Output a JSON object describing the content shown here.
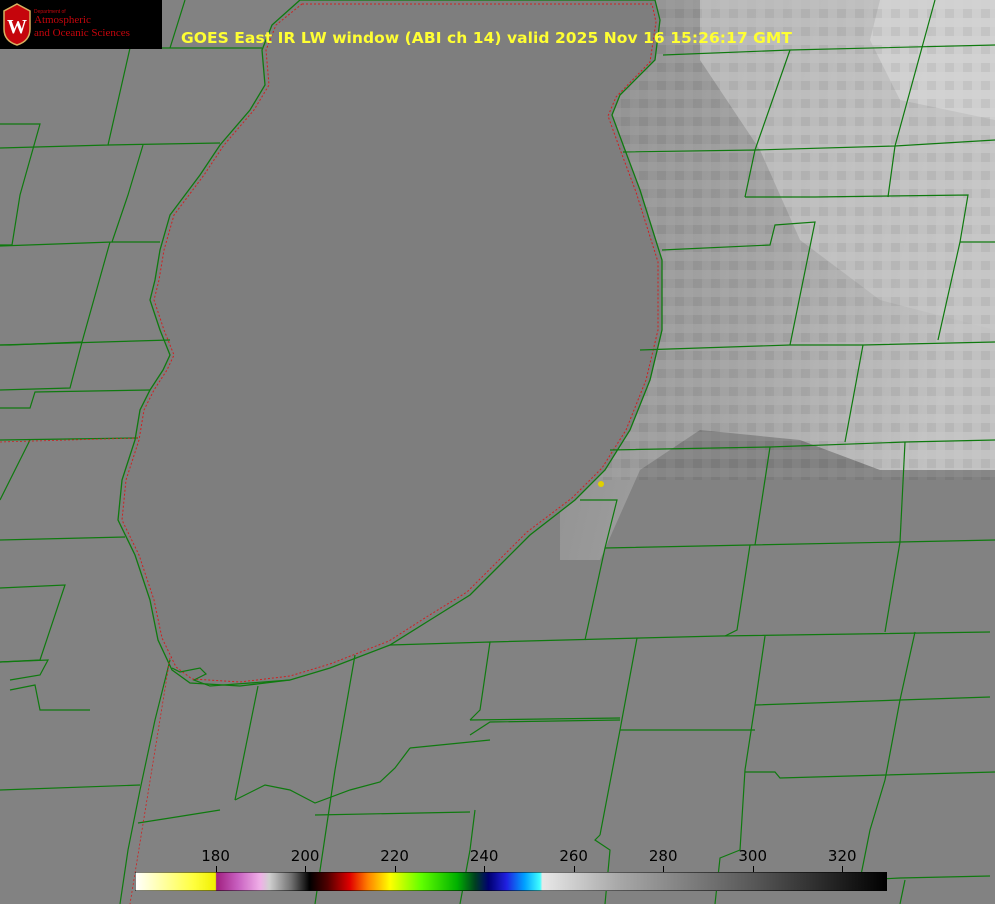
{
  "product_title": "GOES East IR LW window (ABI ch 14) valid 2025 Nov 16 15:26:17 GMT",
  "logo": {
    "department": "Department of",
    "line1": "Atmospheric",
    "line2": "and Oceanic Sciences",
    "crest_letter": "W"
  },
  "colorbar": {
    "unit_range": [
      162,
      330
    ],
    "ticks": [
      "180",
      "200",
      "220",
      "240",
      "260",
      "280",
      "300",
      "320"
    ],
    "stops": [
      {
        "t": 162,
        "c": "#ffffff"
      },
      {
        "t": 175,
        "c": "#ffff40"
      },
      {
        "t": 180,
        "c": "#f0f000"
      },
      {
        "t": 180.2,
        "c": "#a02080"
      },
      {
        "t": 185,
        "c": "#c860c0"
      },
      {
        "t": 190,
        "c": "#f0b0e8"
      },
      {
        "t": 192,
        "c": "#d0d0d0"
      },
      {
        "t": 197,
        "c": "#707070"
      },
      {
        "t": 201,
        "c": "#000000"
      },
      {
        "t": 205,
        "c": "#500000"
      },
      {
        "t": 210,
        "c": "#e00000"
      },
      {
        "t": 214,
        "c": "#ff8000"
      },
      {
        "t": 219,
        "c": "#ffff00"
      },
      {
        "t": 226,
        "c": "#60ff00"
      },
      {
        "t": 234,
        "c": "#00b000"
      },
      {
        "t": 238,
        "c": "#004020"
      },
      {
        "t": 241,
        "c": "#000070"
      },
      {
        "t": 245,
        "c": "#2020e0"
      },
      {
        "t": 249,
        "c": "#00a0ff"
      },
      {
        "t": 252.5,
        "c": "#40ffff"
      },
      {
        "t": 253,
        "c": "#e8e8e8"
      },
      {
        "t": 270,
        "c": "#a8a8a8"
      },
      {
        "t": 300,
        "c": "#585858"
      },
      {
        "t": 330,
        "c": "#000000"
      }
    ]
  },
  "colors": {
    "boundary": "#0f7a0f",
    "lake_outline": "#d02020",
    "land_gray": "#808080",
    "cloud_gray": "#b8b8b8",
    "title": "#ffff33",
    "marker": "#e0d000"
  }
}
